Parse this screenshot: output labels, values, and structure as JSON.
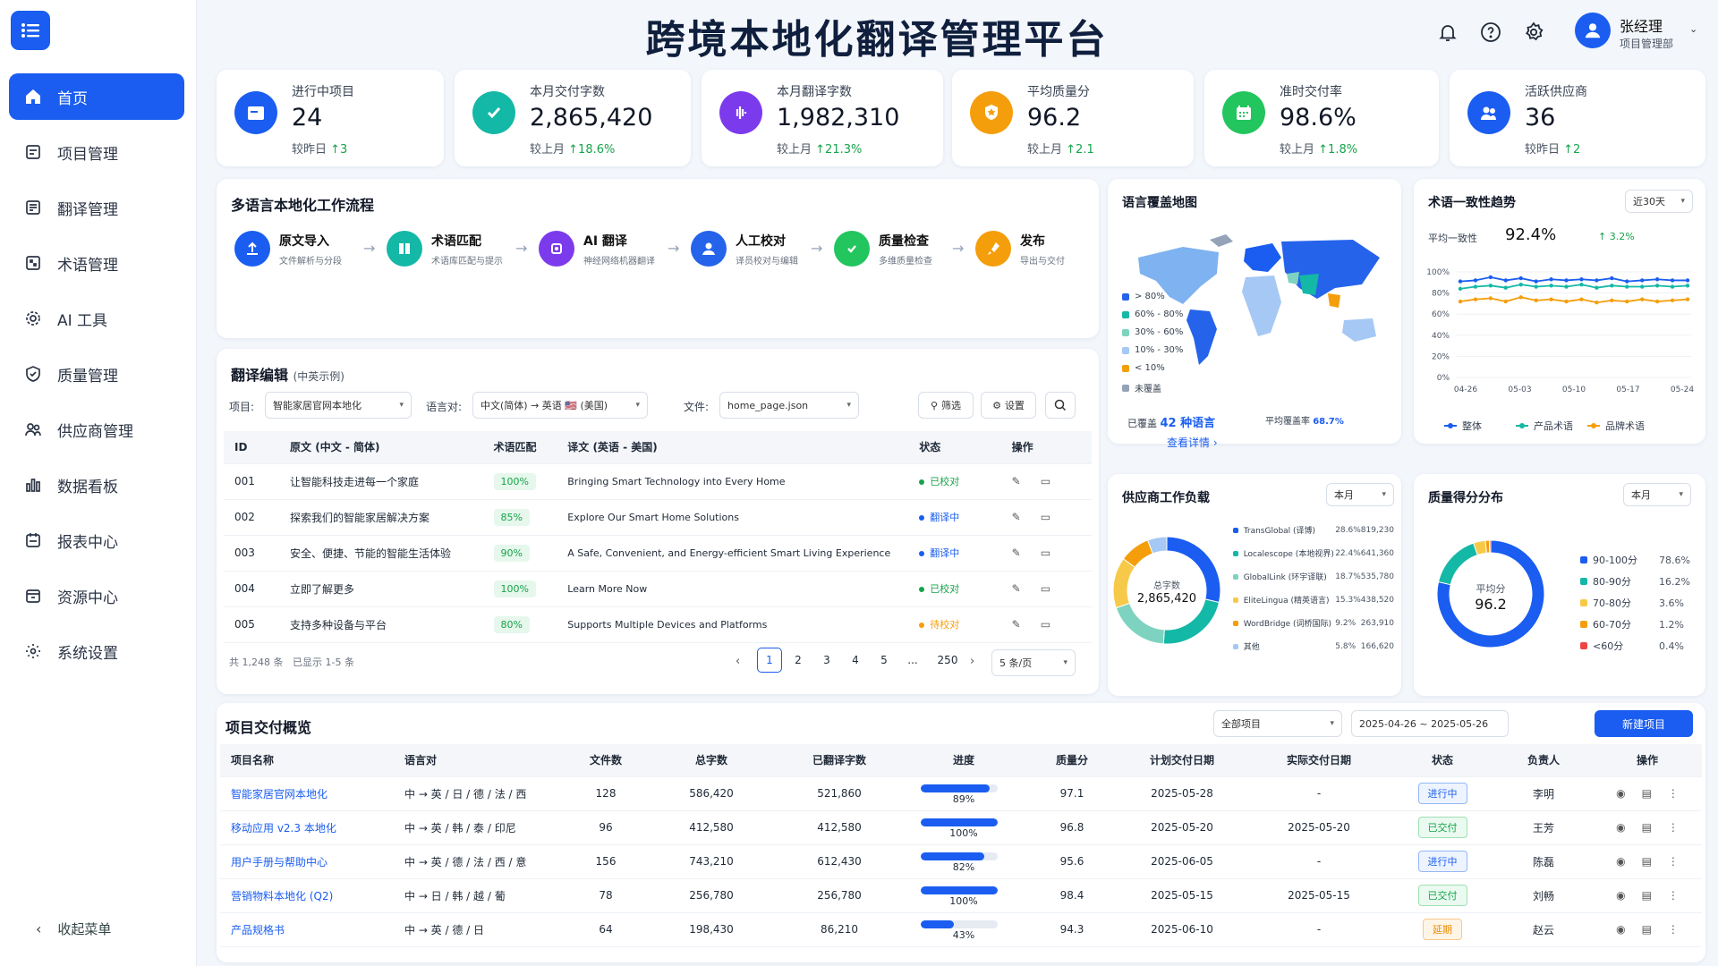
{
  "app": {
    "title": "跨境本地化翻译管理平台"
  },
  "user": {
    "name": "张经理",
    "dept": "项目管理部"
  },
  "nav": [
    {
      "label": "首页",
      "icon": "home-icon",
      "active": true
    },
    {
      "label": "项目管理",
      "icon": "project-icon"
    },
    {
      "label": "翻译管理",
      "icon": "translate-icon"
    },
    {
      "label": "术语管理",
      "icon": "term-icon"
    },
    {
      "label": "AI 工具",
      "icon": "ai-icon"
    },
    {
      "label": "质量管理",
      "icon": "shield-icon"
    },
    {
      "label": "供应商管理",
      "icon": "vendor-icon"
    },
    {
      "label": "数据看板",
      "icon": "chart-icon"
    },
    {
      "label": "报表中心",
      "icon": "report-icon"
    },
    {
      "label": "资源中心",
      "icon": "resource-icon"
    },
    {
      "label": "系统设置",
      "icon": "settings-icon"
    }
  ],
  "collapse_label": "收起菜单",
  "stats": [
    {
      "label": "进行中项目",
      "value": "24",
      "change_prefix": "较昨日",
      "change": "↑3",
      "color": "#1a5df0"
    },
    {
      "label": "本月交付字数",
      "value": "2,865,420",
      "change_prefix": "较上月",
      "change": "↑18.6%",
      "color": "#14b8a6"
    },
    {
      "label": "本月翻译字数",
      "value": "1,982,310",
      "change_prefix": "较上月",
      "change": "↑21.3%",
      "color": "#7c3aed"
    },
    {
      "label": "平均质量分",
      "value": "96.2",
      "change_prefix": "较上月",
      "change": "↑2.1",
      "color": "#f59e0b"
    },
    {
      "label": "准时交付率",
      "value": "98.6%",
      "change_prefix": "较上月",
      "change": "↑1.8%",
      "color": "#22c55e"
    },
    {
      "label": "活跃供应商",
      "value": "36",
      "change_prefix": "较昨日",
      "change": "↑2",
      "color": "#1a5df0"
    }
  ],
  "workflow": {
    "title": "多语言本地化工作流程",
    "steps": [
      {
        "label": "原文导入",
        "desc": "文件解析与分段",
        "color": "#1a5df0"
      },
      {
        "label": "术语匹配",
        "desc": "术语库匹配与提示",
        "color": "#14b8a6"
      },
      {
        "label": "AI 翻译",
        "desc": "神经网络机器翻译",
        "color": "#7c3aed"
      },
      {
        "label": "人工校对",
        "desc": "译员校对与编辑",
        "color": "#2563eb"
      },
      {
        "label": "质量检查",
        "desc": "多维质量检查",
        "color": "#22c55e"
      },
      {
        "label": "发布",
        "desc": "导出与交付",
        "color": "#f59e0b"
      }
    ]
  },
  "editor": {
    "title": "翻译编辑",
    "subtitle": "(中英示例)",
    "project_label": "项目:",
    "project_value": "智能家居官网本地化",
    "lang_label": "语言对:",
    "lang_value": "中文(简体) → 英语 🇺🇸 (美国)",
    "file_label": "文件:",
    "file_value": "home_page.json",
    "filter_label": "筛选",
    "settings_label": "设置",
    "headers": [
      "ID",
      "原文 (中文 - 简体)",
      "术语匹配",
      "译文 (英语 - 美国)",
      "状态",
      "操作"
    ],
    "rows": [
      {
        "id": "001",
        "src": "让智能科技走进每一个家庭",
        "match": "100%",
        "tgt": "Bringing Smart Technology into Every Home",
        "status": "已校对",
        "scolor": "#16a34a"
      },
      {
        "id": "002",
        "src": "探索我们的智能家居解决方案",
        "match": "85%",
        "tgt": "Explore Our Smart Home Solutions",
        "status": "翻译中",
        "scolor": "#1a5df0"
      },
      {
        "id": "003",
        "src": "安全、便捷、节能的智能生活体验",
        "match": "90%",
        "tgt": "A Safe, Convenient, and Energy-efficient Smart Living Experience",
        "status": "翻译中",
        "scolor": "#1a5df0"
      },
      {
        "id": "004",
        "src": "立即了解更多",
        "match": "100%",
        "tgt": "Learn More Now",
        "status": "已校对",
        "scolor": "#16a34a"
      },
      {
        "id": "005",
        "src": "支持多种设备与平台",
        "match": "80%",
        "tgt": "Supports Multiple Devices and Platforms",
        "status": "待校对",
        "scolor": "#f59e0b"
      }
    ],
    "total": "共 1,248 条",
    "shown": "已显示 1-5 条",
    "pages": [
      "1",
      "2",
      "3",
      "4",
      "5",
      "...",
      "250"
    ],
    "page_size": "5 条/页"
  },
  "map": {
    "title": "语言覆盖地图",
    "legend": [
      {
        "label": "> 80%",
        "color": "#2563eb"
      },
      {
        "label": "60% - 80%",
        "color": "#14b8a6"
      },
      {
        "label": "30% - 60%",
        "color": "#7dd3c0"
      },
      {
        "label": "10% - 30%",
        "color": "#a5c8f5"
      },
      {
        "label": "< 10%",
        "color": "#f59e0b"
      },
      {
        "label": "未覆盖",
        "color": "#94a3b8"
      }
    ],
    "covered_label": "已覆盖",
    "covered_value": "42 种语言",
    "avg_label": "平均覆盖率",
    "avg_value": "68.7%",
    "detail_link": "查看详情 ›"
  },
  "term": {
    "title": "术语一致性趋势",
    "range": "近30天",
    "avg_label": "平均一致性",
    "avg_value": "92.4%",
    "change": "↑ 3.2%"
  },
  "term_chart": {
    "type": "line",
    "x": [
      "04-26",
      "05-03",
      "05-10",
      "05-17",
      "05-24"
    ],
    "yticks": [
      "100%",
      "80%",
      "60%",
      "40%",
      "20%",
      "0%"
    ],
    "ylim": [
      0,
      100
    ],
    "series": [
      {
        "name": "整体",
        "color": "#1a5df0",
        "values": [
          91,
          92,
          95,
          92,
          94,
          91,
          93,
          92,
          93,
          92,
          94,
          91,
          92,
          93,
          92,
          92
        ]
      },
      {
        "name": "产品术语",
        "color": "#14b8a6",
        "values": [
          84,
          86,
          87,
          85,
          88,
          86,
          87,
          86,
          88,
          85,
          87,
          86,
          86,
          87,
          86,
          87
        ]
      },
      {
        "name": "品牌术语",
        "color": "#f59e0b",
        "values": [
          72,
          74,
          75,
          72,
          76,
          73,
          74,
          72,
          74,
          71,
          73,
          72,
          74,
          72,
          73,
          74
        ]
      }
    ]
  },
  "vendor": {
    "title": "供应商工作负载",
    "range": "本月",
    "center_label": "总字数",
    "center_value": "2,865,420",
    "items": [
      {
        "name": "TransGlobal (译博)",
        "pct": "28.6%",
        "words": "819,230",
        "value": 28.6,
        "color": "#1a5df0"
      },
      {
        "name": "Localescope (本地视界)",
        "pct": "22.4%",
        "words": "641,360",
        "value": 22.4,
        "color": "#14b8a6"
      },
      {
        "name": "GlobalLink (环宇译联)",
        "pct": "18.7%",
        "words": "535,780",
        "value": 18.7,
        "color": "#7dd3c0"
      },
      {
        "name": "EliteLingua (精英语言)",
        "pct": "15.3%",
        "words": "438,520",
        "value": 15.3,
        "color": "#f7c948"
      },
      {
        "name": "WordBridge (词桥国际)",
        "pct": "9.2%",
        "words": "263,910",
        "value": 9.2,
        "color": "#f59e0b"
      },
      {
        "name": "其他",
        "pct": "5.8%",
        "words": "166,620",
        "value": 5.8,
        "color": "#a5c8f5"
      }
    ]
  },
  "quality": {
    "title": "质量得分分布",
    "range": "本月",
    "center_label": "平均分",
    "center_value": "96.2",
    "items": [
      {
        "name": "90-100分",
        "pct": "78.6%",
        "value": 78.6,
        "color": "#1a5df0"
      },
      {
        "name": "80-90分",
        "pct": "16.2%",
        "value": 16.2,
        "color": "#14b8a6"
      },
      {
        "name": "70-80分",
        "pct": "3.6%",
        "value": 3.6,
        "color": "#f7c948"
      },
      {
        "name": "60-70分",
        "pct": "1.2%",
        "value": 1.2,
        "color": "#f59e0b"
      },
      {
        "name": "<60分",
        "pct": "0.4%",
        "value": 0.4,
        "color": "#ef4444"
      }
    ]
  },
  "projects": {
    "title": "项目交付概览",
    "filter": "全部项目",
    "date_range": "2025-04-26 ~ 2025-05-26",
    "new_label": "新建项目",
    "headers": [
      "项目名称",
      "语言对",
      "文件数",
      "总字数",
      "已翻译字数",
      "进度",
      "质量分",
      "计划交付日期",
      "实际交付日期",
      "状态",
      "负责人",
      "操作"
    ],
    "rows": [
      {
        "name": "智能家居官网本地化",
        "langs": "中 → 英 / 日 / 德 / 法 / 西",
        "files": "128",
        "total": "586,420",
        "done": "521,860",
        "progress": "89%",
        "pv": 89,
        "score": "97.1",
        "plan": "2025-05-28",
        "actual": "-",
        "status": "进行中",
        "stype": "blue",
        "owner": "李明"
      },
      {
        "name": "移动应用 v2.3 本地化",
        "langs": "中 → 英 / 韩 / 泰 / 印尼",
        "files": "96",
        "total": "412,580",
        "done": "412,580",
        "progress": "100%",
        "pv": 100,
        "score": "96.8",
        "plan": "2025-05-20",
        "actual": "2025-05-20",
        "status": "已交付",
        "stype": "green",
        "owner": "王芳"
      },
      {
        "name": "用户手册与帮助中心",
        "langs": "中 → 英 / 德 / 法 / 西 / 意",
        "files": "156",
        "total": "743,210",
        "done": "612,430",
        "progress": "82%",
        "pv": 82,
        "score": "95.6",
        "plan": "2025-06-05",
        "actual": "-",
        "status": "进行中",
        "stype": "blue",
        "owner": "陈磊"
      },
      {
        "name": "营销物料本地化 (Q2)",
        "langs": "中 → 日 / 韩 / 越 / 葡",
        "files": "78",
        "total": "256,780",
        "done": "256,780",
        "progress": "100%",
        "pv": 100,
        "score": "98.4",
        "plan": "2025-05-15",
        "actual": "2025-05-15",
        "status": "已交付",
        "stype": "green",
        "owner": "刘畅"
      },
      {
        "name": "产品规格书",
        "langs": "中 → 英 / 德 / 日",
        "files": "64",
        "total": "198,430",
        "done": "86,210",
        "progress": "43%",
        "pv": 43,
        "score": "94.3",
        "plan": "2025-06-10",
        "actual": "-",
        "status": "延期",
        "stype": "orange",
        "owner": "赵云"
      }
    ]
  }
}
